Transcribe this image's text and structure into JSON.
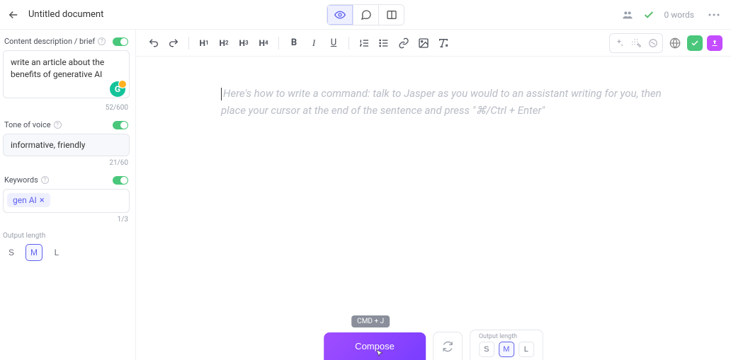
{
  "header": {
    "title": "Untitled document",
    "word_count": "0 words"
  },
  "sidebar": {
    "brief": {
      "label": "Content description / brief",
      "value": "write an article about the benefits of generative AI",
      "counter": "52/600"
    },
    "tone": {
      "label": "Tone of voice",
      "value": "informative, friendly",
      "counter": "21/60"
    },
    "keywords": {
      "label": "Keywords",
      "chip": "gen AI",
      "counter": "1/3"
    },
    "output_length": {
      "label": "Output length",
      "options": [
        "S",
        "M",
        "L"
      ],
      "selected": "M"
    }
  },
  "editor": {
    "placeholder": "Here's how to write a command: talk to Jasper as you would to an assistant writing for you, then place your cursor at the end of the sentence and press \"⌘/Ctrl + Enter\""
  },
  "bottom": {
    "hint": "CMD + J",
    "compose": "Compose",
    "output_length": {
      "label": "Output length",
      "options": [
        "S",
        "M",
        "L"
      ],
      "selected": "M"
    }
  },
  "grammarly_badge_count": "1"
}
